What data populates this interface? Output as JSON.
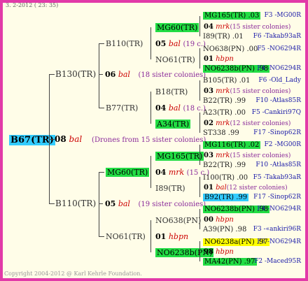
{
  "header": "3. 2-2012 ( 23: 35)",
  "footer": "Copyright 2004-2012 @ Karl Kehrle Foundation.",
  "root": {
    "id": "B67(TR)",
    "num": "08",
    "code": "bal",
    "note": "(Drones from 15 sister colonies)"
  },
  "gen1": [
    {
      "id": "B130(TR)",
      "num": "06",
      "code": "bal",
      "note": "(18 sister colonies)"
    },
    {
      "id": "B110(TR)",
      "num": "05",
      "code": "bal",
      "note": "(19 sister colonies)"
    }
  ],
  "gen2": [
    {
      "id": "B110(TR)",
      "num": "05",
      "code": "bal",
      "note": "(19 c.)"
    },
    {
      "id": "B77(TR)",
      "num": "04",
      "code": "bal",
      "note": "(18 c.)"
    },
    {
      "id": "MG60(TR)",
      "num": "04",
      "code": "mrk",
      "note": "(15 c.)"
    },
    {
      "id": "NO61(TR)",
      "num": "01",
      "code": "hbpn",
      "note": ""
    }
  ],
  "gen3": [
    {
      "id": "MG60(TR)"
    },
    {
      "id": "NO61(TR)"
    },
    {
      "id": "B18(TR)"
    },
    {
      "id": "A34(TR)"
    },
    {
      "id": "MG165(TR)"
    },
    {
      "id": "I89(TR)"
    },
    {
      "id": "NO638(PN)"
    },
    {
      "id": "NO6238b(PN)"
    }
  ],
  "gen3mid": [
    {
      "num": "04",
      "code": "mrk",
      "note": "(15 sister colonies)"
    },
    {
      "num": "01",
      "code": "hbpn",
      "note": ""
    },
    {
      "num": "03",
      "code": "mrk",
      "note": "(15 sister colonies)"
    },
    {
      "num": "02",
      "code": "mrk",
      "note": "(12 sister colonies)"
    },
    {
      "num": "03",
      "code": "mrk",
      "note": "(15 sister colonies)"
    },
    {
      "num": "01",
      "code": "bal",
      "note": "(12 sister colonies)"
    },
    {
      "num": "00",
      "code": "hbpn",
      "note": ""
    },
    {
      "num": "98",
      "code": "hbpn",
      "note": ""
    }
  ],
  "gen4": [
    {
      "id": "MG165(TR) .03",
      "right": "F3 -MG00R"
    },
    {
      "id": "I89(TR) .01",
      "right": "F6 -Takab93aR"
    },
    {
      "id": "NO638(PN) .00",
      "right": "F5 -NO6294R"
    },
    {
      "id": "NO6238b(PN) .98",
      "right": "F4 -NO6294R"
    },
    {
      "id": "B105(TR) .01",
      "right": "F6 -Old_Lady"
    },
    {
      "id": "B22(TR) .99",
      "right": "F10 -Atlas85R"
    },
    {
      "id": "A23(TR) .00",
      "right": "F5 -Cankiri97Q"
    },
    {
      "id": "ST338 .99",
      "right": "F17 -Sinop62R"
    },
    {
      "id": "MG116(TR) .02",
      "right": "F2 -MG00R"
    },
    {
      "id": "B22(TR) .99",
      "right": "F10 -Atlas85R"
    },
    {
      "id": "I100(TR) .00",
      "right": "F5 -Takab93aR"
    },
    {
      "id": "B92(TR) .99",
      "right": "F17 -Sinop62R"
    },
    {
      "id": "NO6238b(PN) .98",
      "right": "F4 -NO6294R"
    },
    {
      "id": "A39(PN) .98",
      "right": "F3 -«ankiri96R"
    },
    {
      "id": "NO6238a(PN) .97",
      "right": "F3 -NO6294R"
    },
    {
      "id": "MA42(PN) .97",
      "right": "F2 -Maced95R"
    }
  ]
}
